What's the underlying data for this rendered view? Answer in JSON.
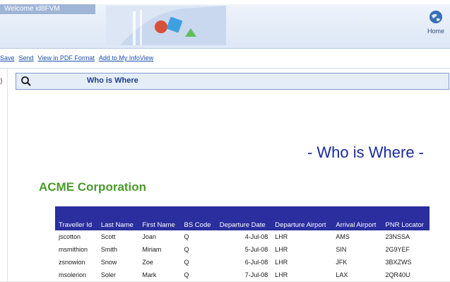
{
  "header": {
    "welcome_text": "Welcome id8FVM",
    "home_label": "Home"
  },
  "toolbar": {
    "save": "Save",
    "send": "Send",
    "pdf": "View in PDF Format",
    "infoview": "Add to My InfoView"
  },
  "search": {
    "title": "Who is Where",
    "icon": "magnifier-icon"
  },
  "report": {
    "title": "- Who is Where -",
    "company": "ACME Corporation",
    "columns": [
      "Traveller Id",
      "Last Name",
      "First Name",
      "BS Code",
      "Departure Date",
      "Departure Airport",
      "Arrival Airport",
      "PNR Locator"
    ],
    "rows": [
      [
        "jscotton",
        "Scott",
        "Joan",
        "Q",
        "4-Jul-08",
        "LHR",
        "AMS",
        "23NSSA"
      ],
      [
        "msmithion",
        "Smith",
        "Miriam",
        "Q",
        "5-Jul-08",
        "LHR",
        "SIN",
        "2G9YEF"
      ],
      [
        "zsnowion",
        "Snow",
        "Zoe",
        "Q",
        "6-Jul-08",
        "LHR",
        "JFK",
        "3BXZWS"
      ],
      [
        "msolerion",
        "Soler",
        "Mark",
        "Q",
        "7-Jul-08",
        "LHR",
        "LAX",
        "2QR40U"
      ]
    ]
  },
  "colors": {
    "header_blue": "#2a2e9e",
    "title_blue": "#1b2b9a",
    "company_green": "#4a9a2a",
    "link_blue": "#1a4fae"
  }
}
